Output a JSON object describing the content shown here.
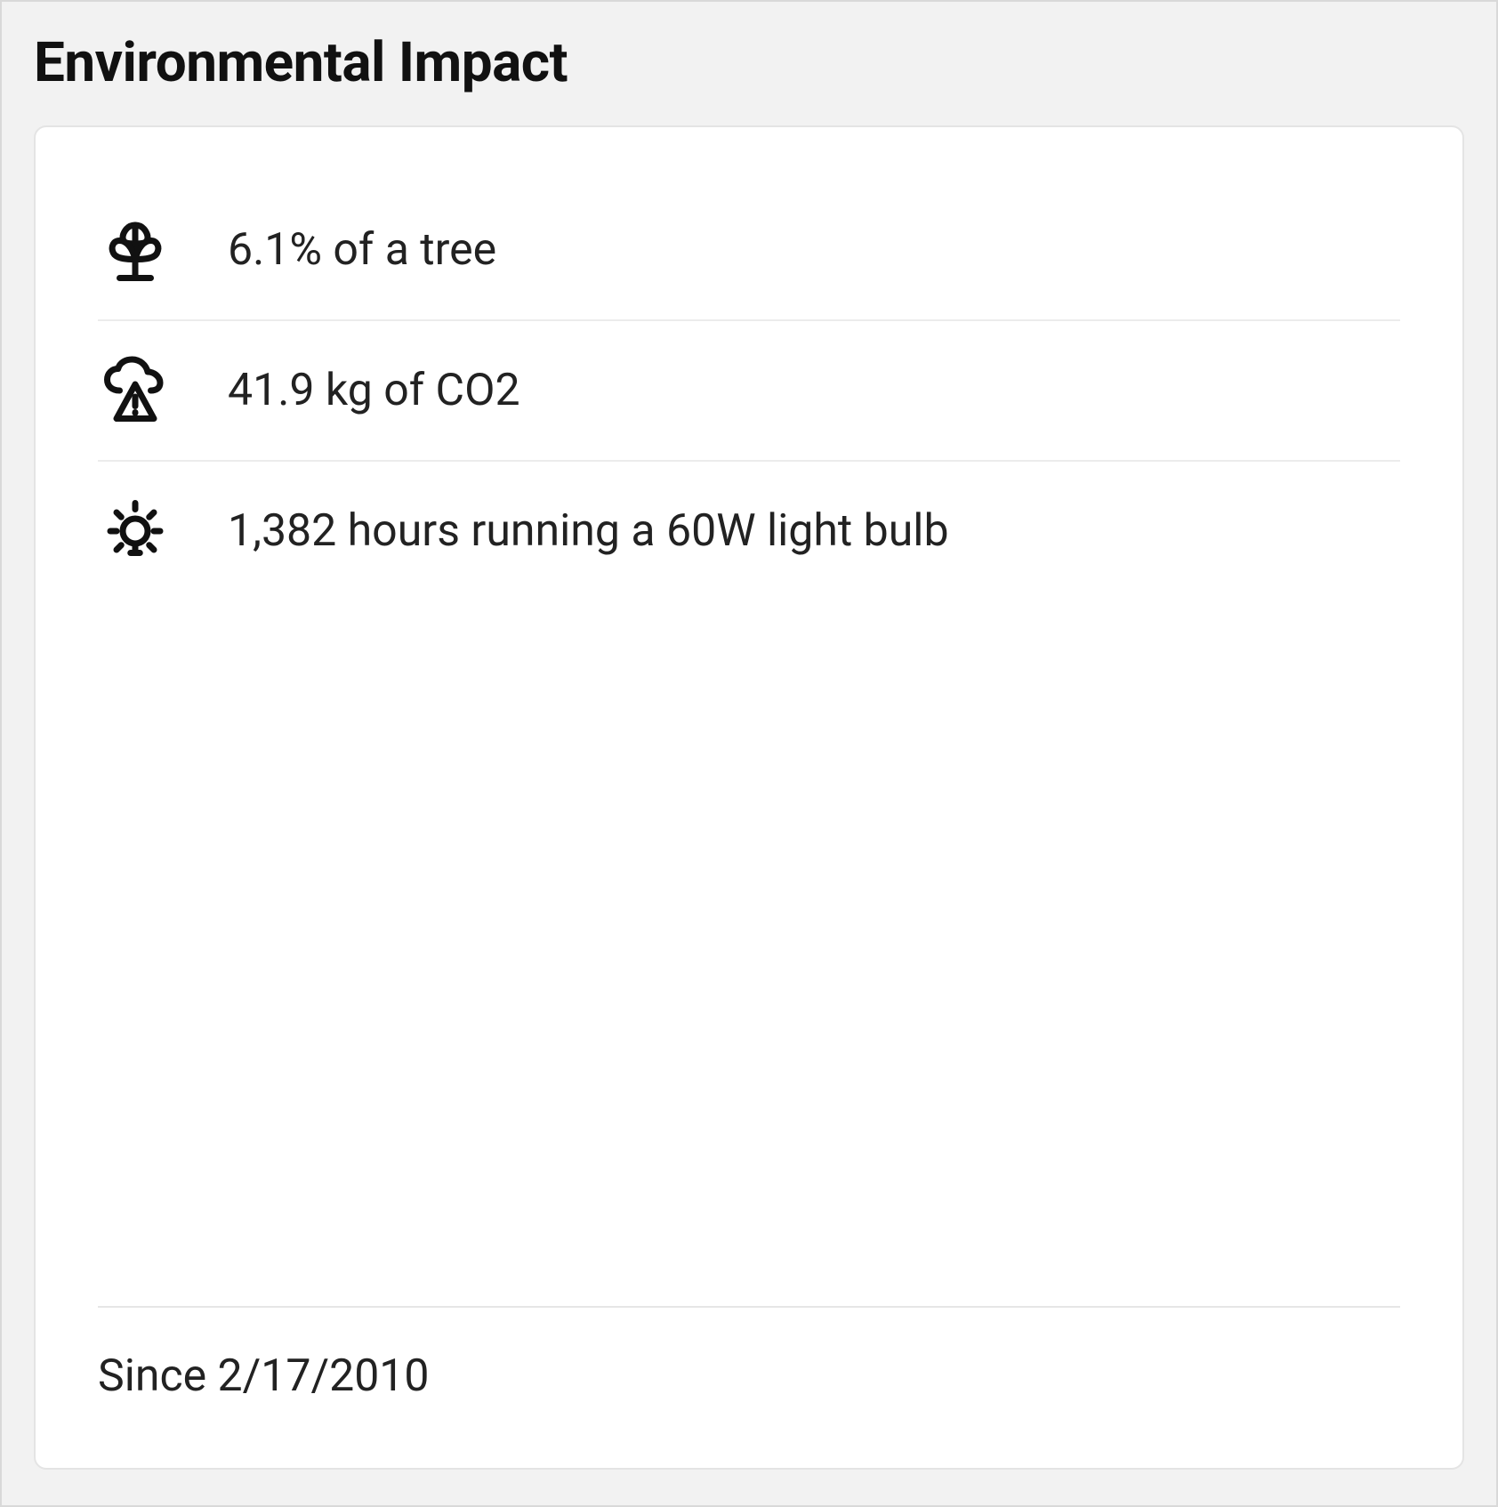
{
  "panel": {
    "title": "Environmental Impact",
    "metrics": [
      {
        "icon": "plant-icon",
        "label": "6.1% of a tree"
      },
      {
        "icon": "cloud-warning-icon",
        "label": "41.9 kg of CO2"
      },
      {
        "icon": "lightbulb-icon",
        "label": "1,382 hours running a 60W light bulb"
      }
    ],
    "footer": "Since 2/17/2010"
  }
}
